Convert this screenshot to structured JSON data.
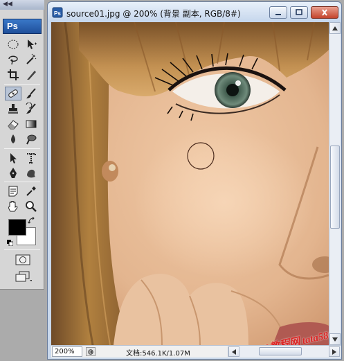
{
  "toolbox": {
    "grip": "◀◀",
    "logo": "Ps",
    "tools": [
      "marquee",
      "move",
      "lasso",
      "magic-wand",
      "crop",
      "slice",
      "healing-brush",
      "brush",
      "clone-stamp",
      "history-brush",
      "eraser",
      "gradient",
      "blur",
      "dodge",
      "path-selection",
      "type",
      "pen",
      "custom-shape",
      "notes",
      "eyedropper",
      "hand",
      "zoom"
    ],
    "selected_tool": "healing-brush",
    "foreground_color": "#000000",
    "background_color": "#ffffff"
  },
  "document": {
    "title": "source01.jpg @ 200% (背景 副本, RGB/8#)",
    "zoom": "200%",
    "doc_info": "文档:546.1K/1.07M",
    "watermark": "PS教程网 tata580.com"
  },
  "colors": {
    "title_bar": "#c5d6ec",
    "close_button": "#c4442c",
    "skin": "#e3b894",
    "hair": "#9a6a3a",
    "iris": "#5f7a6a"
  },
  "icons": {
    "doc": "ps-document-icon",
    "minimize": "minimize-icon",
    "restore": "restore-icon",
    "close": "close-icon"
  }
}
